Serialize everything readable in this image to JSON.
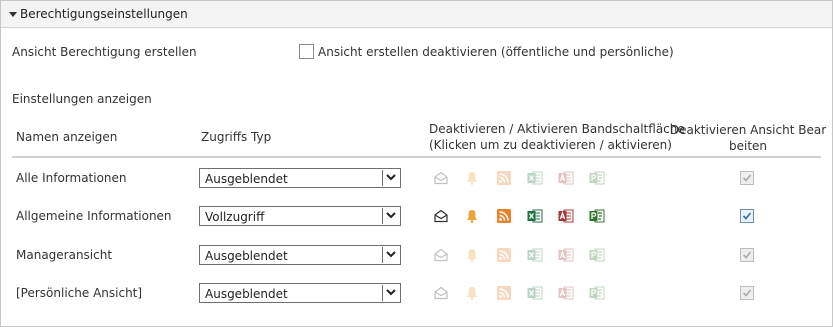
{
  "section": {
    "title": "Berechtigungseinstellungen"
  },
  "create_view": {
    "label": "Ansicht Berechtigung erstellen",
    "checkbox_label": "Ansicht erstellen deaktivieren (öffentliche und persönliche)"
  },
  "display": {
    "heading": "Einstellungen anzeigen"
  },
  "table": {
    "headers": {
      "name": "Namen anzeigen",
      "access": "Zugriffs Typ",
      "ribbon_line1": "Deaktivieren / Aktivieren Bandschaltfläche",
      "ribbon_line2": "(Klicken um zu deaktivieren / aktivieren)",
      "disable_edit_line1": "Deaktivieren Ansicht Bear",
      "disable_edit_line2": "beiten"
    },
    "rows": [
      {
        "name": "Alle Informationen",
        "access": "Ausgeblendet",
        "ribbon_enabled": false,
        "disable_edit_checked": true,
        "disable_edit_enabled": false
      },
      {
        "name": "Allgemeine Informationen",
        "access": "Vollzugriff",
        "ribbon_enabled": true,
        "disable_edit_checked": true,
        "disable_edit_enabled": true
      },
      {
        "name": "Manageransicht",
        "access": "Ausgeblendet",
        "ribbon_enabled": false,
        "disable_edit_checked": true,
        "disable_edit_enabled": false
      },
      {
        "name": "[Persönliche Ansicht]",
        "access": "Ausgeblendet",
        "ribbon_enabled": false,
        "disable_edit_checked": true,
        "disable_edit_enabled": false
      }
    ]
  },
  "ribbon_icons": [
    "envelope-icon",
    "bell-icon",
    "rss-icon",
    "excel-icon",
    "access-icon",
    "project-icon"
  ],
  "colors": {
    "rss": "#e8822a",
    "bell": "#e8a53a",
    "excel": "#1f7244",
    "access": "#a4373a",
    "project": "#31752f",
    "check": "#3a6fa8"
  }
}
